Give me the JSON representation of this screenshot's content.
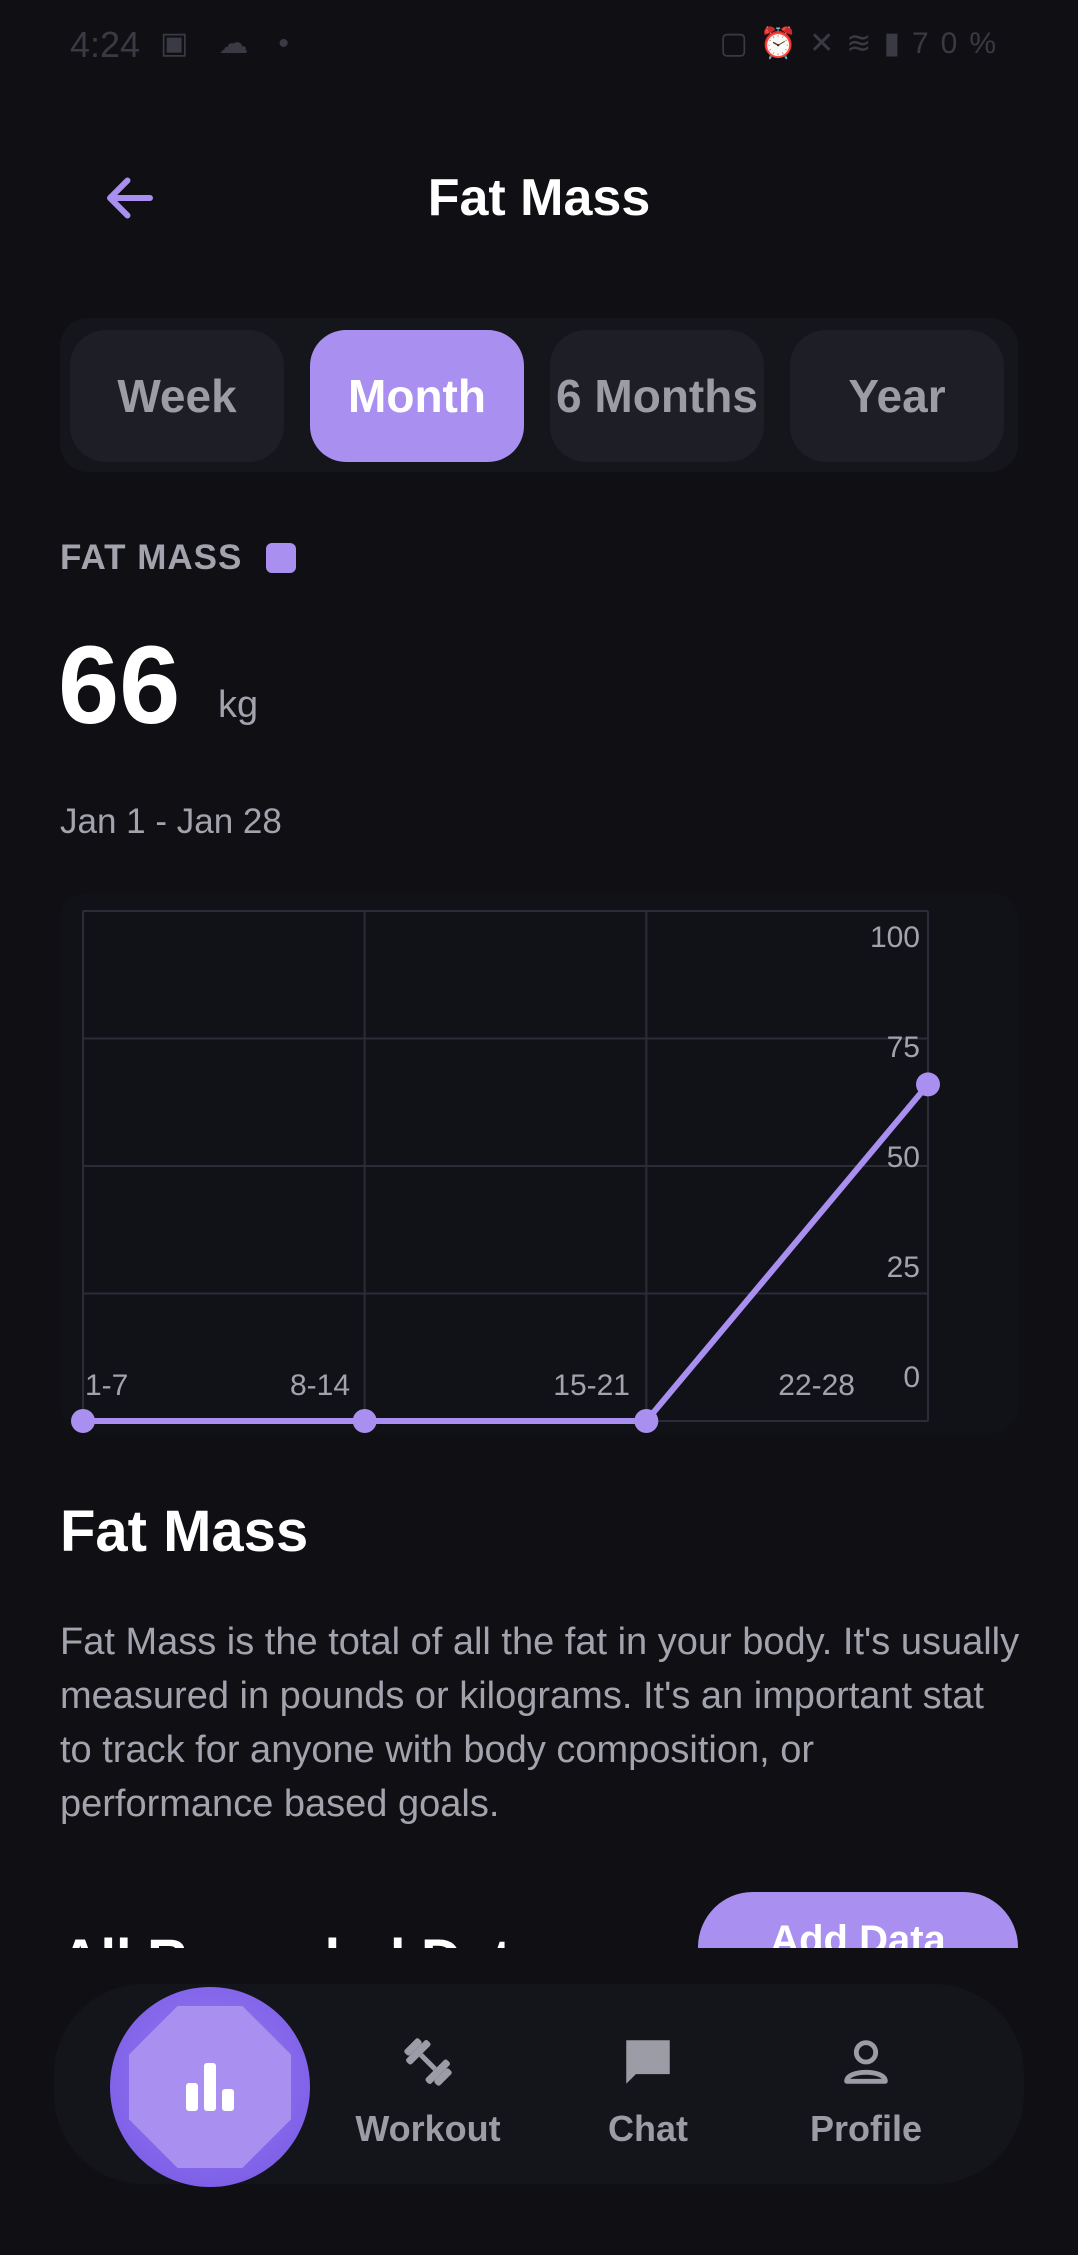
{
  "status_bar": {
    "time": "4:24",
    "battery": "70%",
    "left_icons": [
      "image-icon",
      "cloud-icon",
      "dot-icon"
    ],
    "right_icons": [
      "nfc-icon",
      "alarm-icon",
      "mute-icon",
      "wifi-icon",
      "signal-icon"
    ]
  },
  "header": {
    "title": "Fat Mass",
    "back_icon": "back-arrow-icon"
  },
  "tabs": [
    {
      "label": "Week",
      "active": false
    },
    {
      "label": "Month",
      "active": true
    },
    {
      "label": "6 Months",
      "active": false
    },
    {
      "label": "Year",
      "active": false
    }
  ],
  "metric": {
    "label": "FAT MASS",
    "value": "66",
    "unit": "kg",
    "date_range": "Jan 1 - Jan 28"
  },
  "chart_data": {
    "type": "line",
    "categories": [
      "1-7",
      "8-14",
      "15-21",
      "22-28"
    ],
    "values": [
      0,
      0,
      0,
      66
    ],
    "ylim": [
      0,
      100
    ],
    "yticks": [
      "100",
      "75",
      "50",
      "25",
      "0"
    ],
    "grid": true,
    "color": "#a98ff0"
  },
  "info": {
    "title": "Fat Mass",
    "description": "Fat Mass is the total of all the fat in your body. It's usually measured in pounds or kilograms. It's an important stat to track for anyone with body composition, or performance based goals."
  },
  "recorded": {
    "title": "All Recorded Data",
    "add_button": "Add Data"
  },
  "nav": {
    "stats_icon": "bar-chart-icon",
    "items": [
      {
        "label": "Workout",
        "icon": "dumbbell-icon"
      },
      {
        "label": "Chat",
        "icon": "chat-icon"
      },
      {
        "label": "Profile",
        "icon": "person-icon"
      }
    ]
  },
  "colors": {
    "accent": "#a98ff0",
    "background": "#0f0f14",
    "muted_text": "#a3a3ad"
  }
}
